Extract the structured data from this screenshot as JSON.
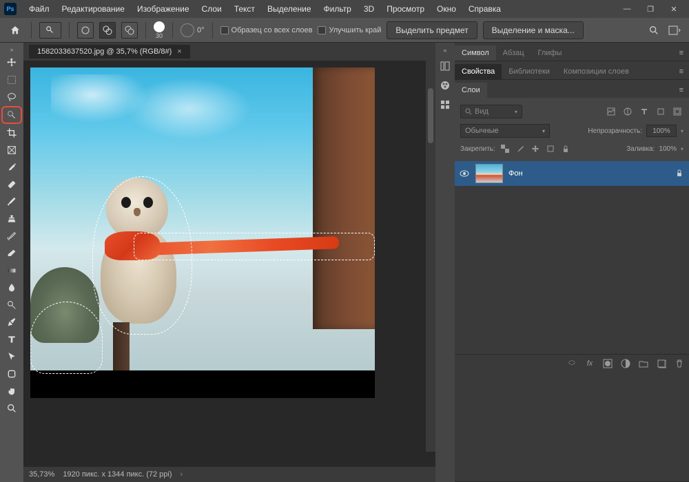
{
  "app": {
    "logo": "Ps"
  },
  "menu": {
    "items": [
      "Файл",
      "Редактирование",
      "Изображение",
      "Слои",
      "Текст",
      "Выделение",
      "Фильтр",
      "3D",
      "Просмотр",
      "Окно",
      "Справка"
    ]
  },
  "window": {
    "min": "—",
    "restore": "❐",
    "close": "✕"
  },
  "optbar": {
    "brush_size": "30",
    "angle_label": "0°",
    "sample_all": "Образец со всех слоев",
    "enhance_edge": "Улучшить край",
    "select_subject": "Выделить предмет",
    "select_and_mask": "Выделение и маска..."
  },
  "tab": {
    "title": "1582033637520.jpg @ 35,7% (RGB/8#)",
    "close": "×"
  },
  "status": {
    "zoom": "35,73%",
    "dims": "1920 пикс. x 1344 пикс. (72 ppi)",
    "chev": "›"
  },
  "panels": {
    "character": {
      "tabs": [
        "Символ",
        "Абзац",
        "Глифы"
      ],
      "active": 0
    },
    "properties": {
      "tabs": [
        "Свойства",
        "Библиотеки",
        "Композиции слоев"
      ],
      "active": 0
    },
    "layers": {
      "tab": "Слои",
      "filter_kind": "Вид",
      "blend_mode": "Обычные",
      "opacity_label": "Непрозрачность:",
      "opacity_value": "100%",
      "lock_label": "Закрепить:",
      "fill_label": "Заливка:",
      "fill_value": "100%",
      "layer_name": "Фон"
    }
  }
}
